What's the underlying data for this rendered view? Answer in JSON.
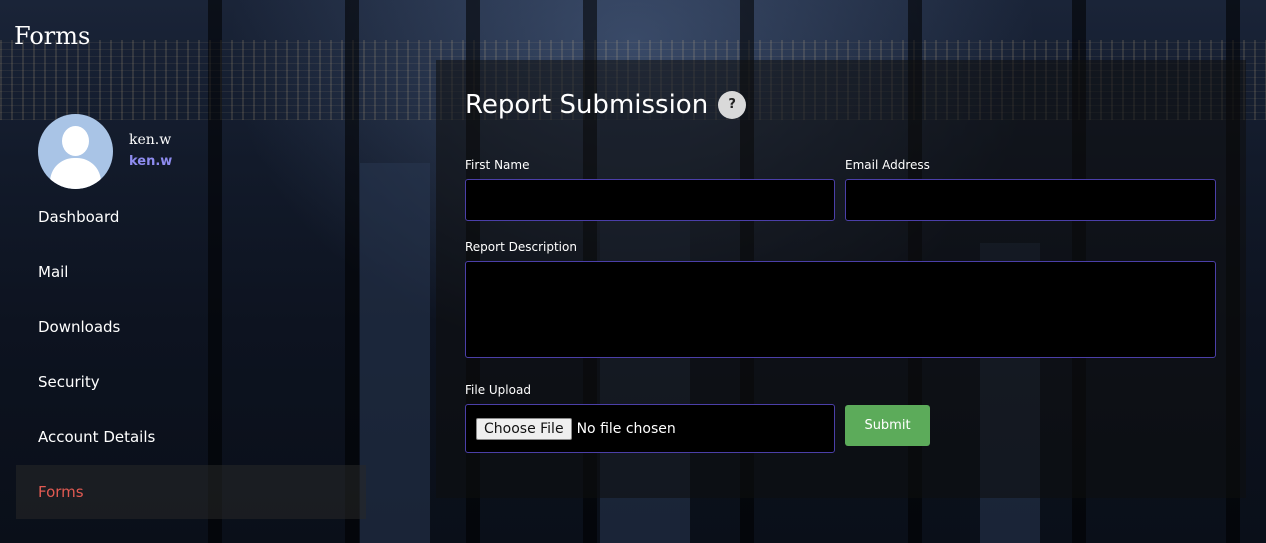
{
  "app": {
    "title": "Forms"
  },
  "profile": {
    "name": "ken.w",
    "link": "ken.w"
  },
  "sidebar": {
    "items": [
      {
        "label": "Dashboard"
      },
      {
        "label": "Mail"
      },
      {
        "label": "Downloads"
      },
      {
        "label": "Security"
      },
      {
        "label": "Account Details"
      },
      {
        "label": "Forms",
        "active": true
      }
    ]
  },
  "form": {
    "title": "Report Submission",
    "help_icon": "?",
    "first_name": {
      "label": "First Name",
      "value": ""
    },
    "email": {
      "label": "Email Address",
      "value": ""
    },
    "description": {
      "label": "Report Description",
      "value": ""
    },
    "file": {
      "label": "File Upload",
      "button": "Choose File",
      "status": "No file chosen"
    },
    "submit_label": "Submit"
  },
  "colors": {
    "accent_active": "#e25a52",
    "link": "#8e8cf0",
    "submit": "#5cab5a",
    "field_border": "#4b3fa8"
  },
  "icons": {
    "avatar": "user-avatar-icon",
    "help": "help-icon"
  }
}
